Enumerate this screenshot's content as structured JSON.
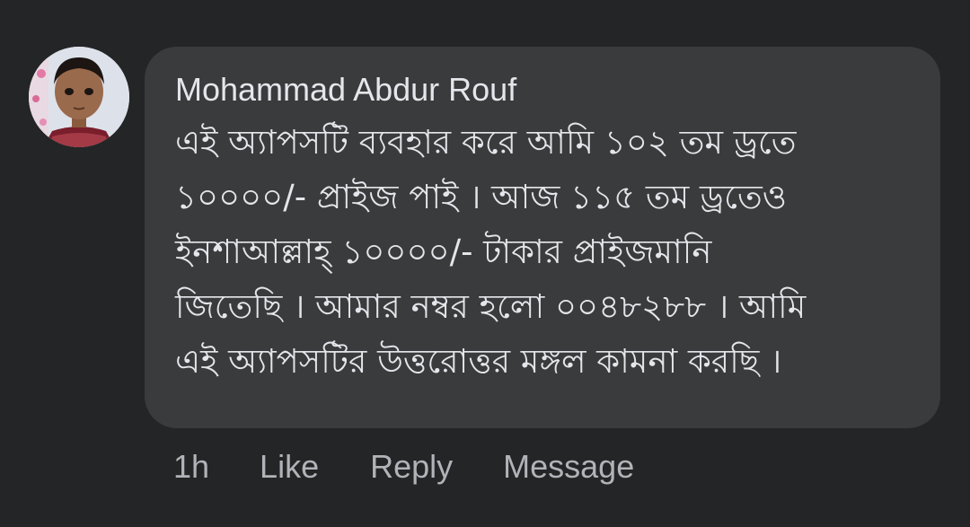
{
  "comment": {
    "author": "Mohammad Abdur Rouf",
    "text_lines": [
      "এই অ্যাপসটি ব্যবহার করে আমি ১০২ তম ড্রতে",
      "১০০০০/- প্রাইজ পাই । আজ ১১৫ তম ড্রতেও",
      "ইনশাআল্লাহ্ ১০০০০/- টাকার প্রাইজমানি",
      "জিতেছি । আমার নম্বর হলো ০০৪৮২৮৮ । আমি",
      "এই অ্যাপসটির উত্তরোত্তর মঙ্গল কামনা করছি ।"
    ]
  },
  "actions": {
    "time": "1h",
    "like": "Like",
    "reply": "Reply",
    "message": "Message"
  },
  "colors": {
    "background": "#242526",
    "bubble": "#3a3b3c",
    "text_primary": "#e4e6eb",
    "text_secondary": "#b0b3b8"
  }
}
